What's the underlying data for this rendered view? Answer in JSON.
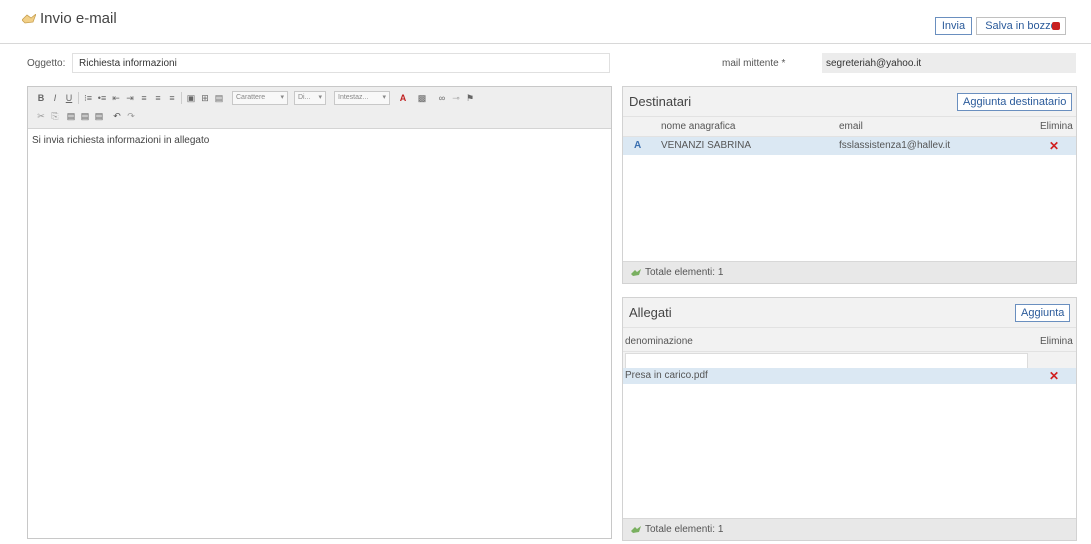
{
  "header": {
    "title": "Invio e-mail",
    "send_label": "Invia",
    "draft_label": "Salva in bozze"
  },
  "form": {
    "subject_label": "Oggetto:",
    "subject_value": "Richiesta informazioni",
    "sender_label": "mail mittente *",
    "sender_value": "segreteriah@yahoo.it"
  },
  "editor": {
    "toolbar_row1": [
      "B",
      "I",
      "U",
      "⁝≡",
      "•≡",
      "⇤",
      "⇥",
      "≡",
      "≡",
      "≡",
      "▣",
      "⊞",
      "▤"
    ],
    "font_select": "Carattere",
    "size_select": "Di...",
    "format_select": "Intestaz...",
    "toolbar_row2": [
      "✂",
      "⎘",
      "▤",
      "▤",
      "▤",
      "↶",
      "↷"
    ],
    "body_text": "Si invia richiesta informazioni in allegato"
  },
  "recipients": {
    "title": "Destinatari",
    "add_label": "Aggiunta destinatario",
    "columns": [
      "nome anagrafica",
      "email",
      "Elimina"
    ],
    "rows": [
      {
        "type_icon": "A",
        "name": "VENANZI SABRINA",
        "email": "fsslassistenza1@hallev.it"
      }
    ],
    "total_label": "Totale elementi: 1"
  },
  "attachments": {
    "title": "Allegati",
    "add_label": "Aggiunta",
    "columns": [
      "denominazione",
      "Elimina"
    ],
    "rows": [
      {
        "name": "Presa in carico.pdf"
      }
    ],
    "total_label": "Totale elementi: 1"
  },
  "colors": {
    "accent_border": "#6a8fbf",
    "selected_row": "#dbe8f3",
    "delete_red": "#d02020"
  }
}
